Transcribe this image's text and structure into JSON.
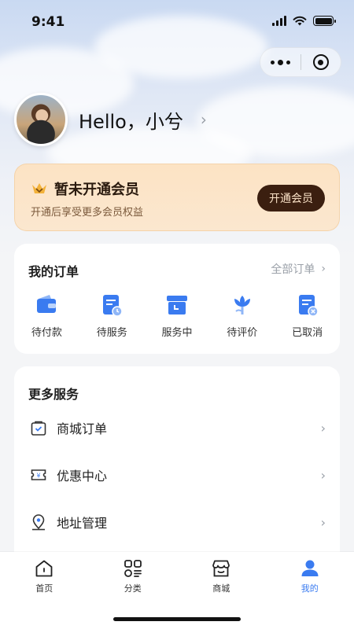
{
  "status": {
    "time": "9:41"
  },
  "profile": {
    "greeting": "Hello，小兮"
  },
  "vip": {
    "title": "暂未开通会员",
    "subtitle": "开通后享受更多会员权益",
    "button": "开通会员"
  },
  "orders": {
    "title": "我的订单",
    "all_label": "全部订单",
    "items": [
      {
        "label": "待付款",
        "icon": "wallet-icon"
      },
      {
        "label": "待服务",
        "icon": "document-clock-icon"
      },
      {
        "label": "服务中",
        "icon": "archive-box-icon"
      },
      {
        "label": "待评价",
        "icon": "flower-icon"
      },
      {
        "label": "已取消",
        "icon": "document-cancel-icon"
      }
    ]
  },
  "services": {
    "title": "更多服务",
    "items": [
      {
        "label": "商城订单",
        "icon": "shopping-bag-icon"
      },
      {
        "label": "优惠中心",
        "icon": "coupon-ticket-icon"
      },
      {
        "label": "地址管理",
        "icon": "location-pin-icon"
      }
    ]
  },
  "tabbar": {
    "items": [
      {
        "label": "首页",
        "icon": "home-icon"
      },
      {
        "label": "分类",
        "icon": "grid-category-icon"
      },
      {
        "label": "商城",
        "icon": "store-icon"
      },
      {
        "label": "我的",
        "icon": "user-icon",
        "active": true
      }
    ]
  },
  "colors": {
    "accent": "#3a7bf0",
    "vip_button": "#3b1f10",
    "vip_bg": "#fce3c4"
  }
}
